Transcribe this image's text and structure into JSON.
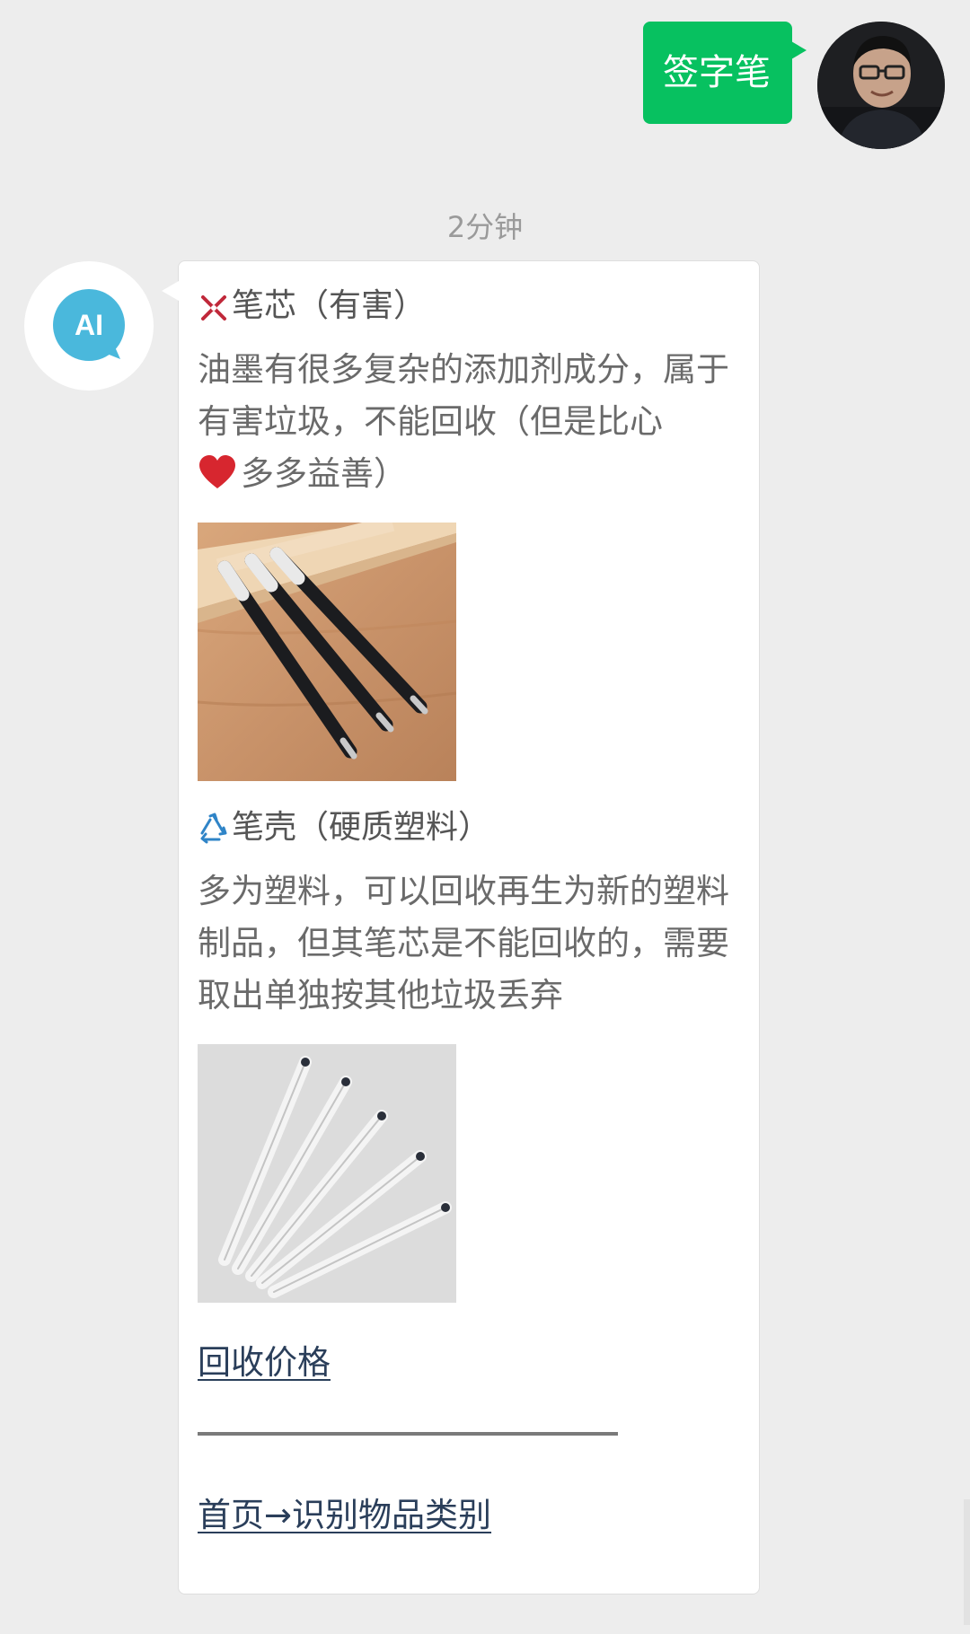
{
  "user_message": {
    "text": "签字笔"
  },
  "timestamp": "2分钟",
  "bot": {
    "avatar_text": "AI",
    "avatar_color": "#4ab8dc",
    "sections": [
      {
        "icon": "harmful-icon",
        "title": "笔芯（有害）",
        "body": "油墨有很多复杂的添加剂成分，属于有害垃圾，不能回收（但是比心",
        "body_tail": "多多益善）",
        "image": "pen-refills-photo"
      },
      {
        "icon": "recycle-icon",
        "title": "笔壳（硬质塑料）",
        "body": "多为塑料，可以回收再生为新的塑料制品，但其笔芯是不能回收的，需要取出单独按其他垃圾丢弃",
        "image": "clear-pens-photo"
      }
    ],
    "links": {
      "price": "回收价格",
      "home": "首页→识别物品类别"
    }
  },
  "colors": {
    "background": "#ededed",
    "user_bubble": "#07c160",
    "bot_bubble": "#ffffff",
    "link": "#2a3e5a",
    "harmful": "#c0283a",
    "recycle": "#2f84c7"
  }
}
